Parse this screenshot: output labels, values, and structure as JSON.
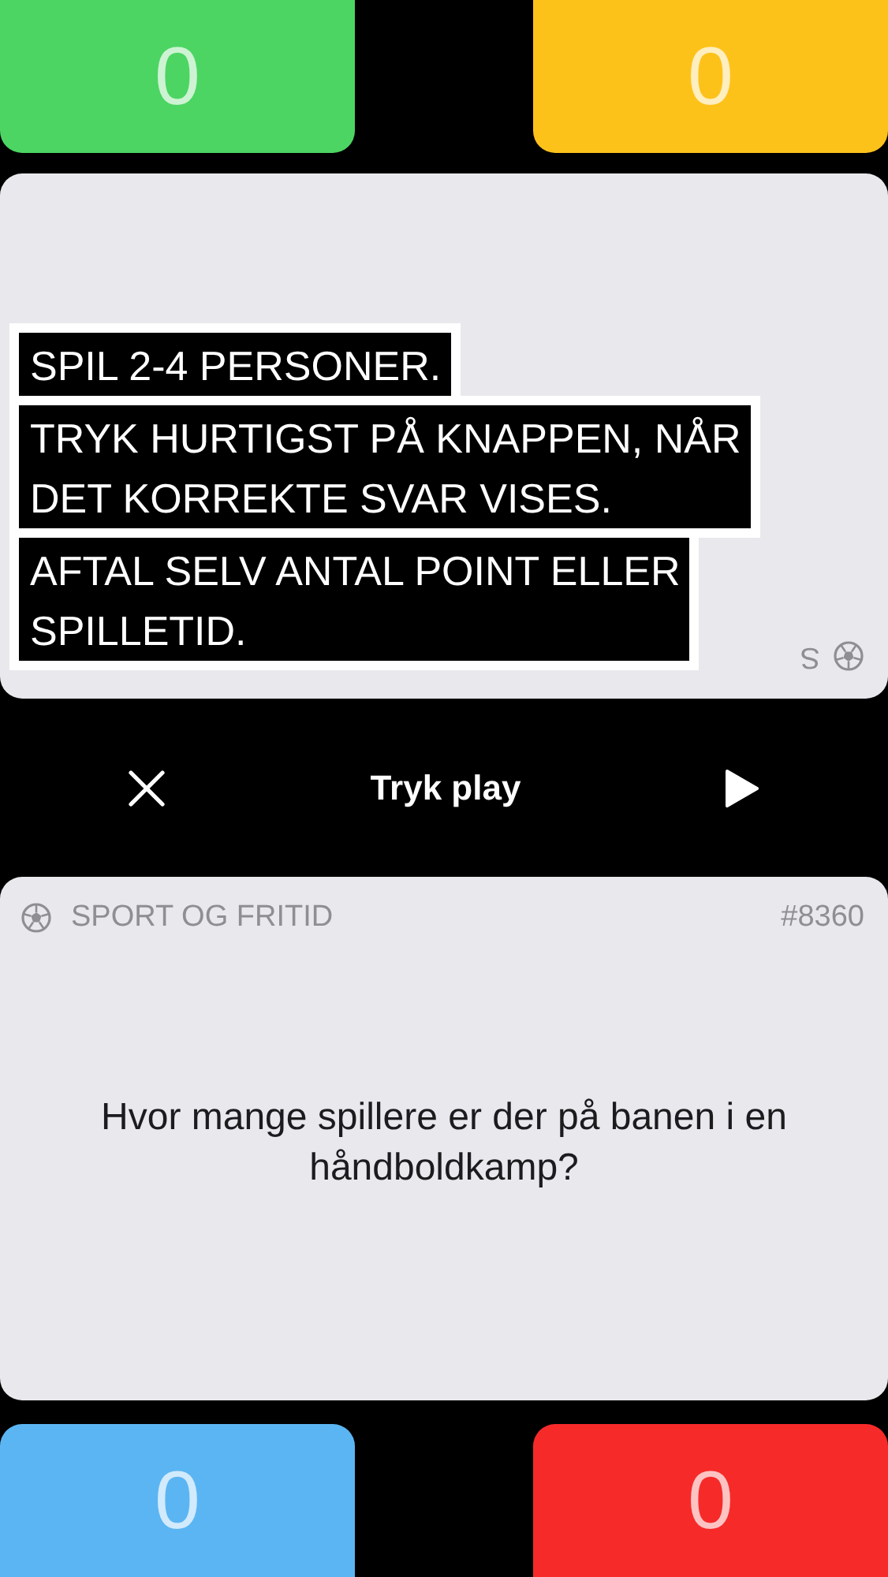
{
  "top_scores": [
    {
      "score": "0",
      "color": "#4cd563"
    },
    {
      "score": "0",
      "color": "#fdc21a"
    }
  ],
  "mirrored_card": {
    "category_fragment": "S"
  },
  "instructions": [
    {
      "lines": [
        "SPIL 2-4 PERSONER."
      ]
    },
    {
      "lines": [
        "TRYK HURTIGST PÅ KNAPPEN, NÅR",
        "DET KORREKTE SVAR VISES."
      ]
    },
    {
      "lines": [
        "AFTAL SELV ANTAL POINT ELLER",
        "SPILLETID."
      ]
    }
  ],
  "controls": {
    "title": "Tryk play"
  },
  "question_card": {
    "category": "SPORT OG FRITID",
    "number": "#8360",
    "question": "Hvor mange spillere er der på banen i en håndboldkamp?"
  },
  "bottom_scores": [
    {
      "score": "0",
      "color": "#5bb5f2"
    },
    {
      "score": "0",
      "color": "#f72a2a"
    }
  ]
}
